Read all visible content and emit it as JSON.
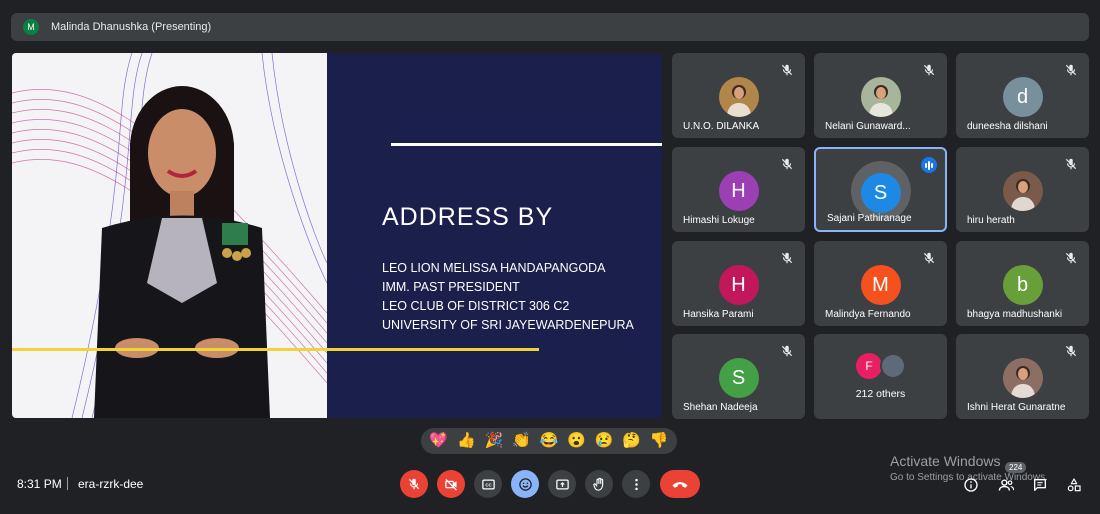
{
  "presenter": {
    "avatar_letter": "M",
    "label": "Malinda Dhanushka (Presenting)"
  },
  "slide": {
    "title": "ADDRESS BY",
    "lines": [
      "LEO LION MELISSA HANDAPANGODA",
      "IMM. PAST PRESIDENT",
      "LEO CLUB OF DISTRICT 306 C2",
      "UNIVERSITY OF SRI JAYEWARDENEPURA"
    ]
  },
  "participants": [
    {
      "name": "U.N.O. DILANKA",
      "avatar": "photo",
      "color": "#b0864a",
      "muted": true
    },
    {
      "name": "Nelani Gunaward...",
      "avatar": "photo",
      "color": "#a7b59a",
      "muted": true
    },
    {
      "name": "duneesha dilshani",
      "avatar": "d",
      "color": "#78909c",
      "muted": true
    },
    {
      "name": "Himashi Lokuge",
      "avatar": "H",
      "color": "#9c3fb5",
      "muted": true
    },
    {
      "name": "Sajani Pathiranage",
      "avatar": "S",
      "color": "#1e88e5",
      "muted": false,
      "speaking": true
    },
    {
      "name": "hiru herath",
      "avatar": "photo",
      "color": "#7a5a4a",
      "muted": true
    },
    {
      "name": "Hansika Parami",
      "avatar": "H",
      "color": "#c2185b",
      "muted": true
    },
    {
      "name": "Malindya Fernando",
      "avatar": "M",
      "color": "#f4511e",
      "muted": true
    },
    {
      "name": "bhagya madhushanki",
      "avatar": "b",
      "color": "#689f38",
      "muted": true
    },
    {
      "name": "Shehan Nadeeja",
      "avatar": "S",
      "color": "#43a047",
      "muted": true
    },
    {
      "name": "212 others",
      "avatar": "group",
      "color": "#e91e63",
      "muted": false,
      "group_letter": "F"
    },
    {
      "name": "Ishni Herat Gunaratne",
      "avatar": "photo",
      "color": "#8d6e63",
      "muted": true
    }
  ],
  "reactions": [
    "💖",
    "👍",
    "🎉",
    "👏",
    "😂",
    "😮",
    "😢",
    "🤔",
    "👎"
  ],
  "meeting": {
    "time": "8:31 PM",
    "code": "era-rzrk-dee"
  },
  "watermark": {
    "title": "Activate Windows",
    "subtitle": "Go to Settings to activate Windows."
  },
  "people_count": "224",
  "colors": {
    "background": "#202124",
    "tile": "#3c4043",
    "danger": "#ea4335",
    "accent": "#8ab4f8"
  },
  "controls": [
    "mic-off-icon",
    "camera-off-icon",
    "captions-icon",
    "emoji-icon",
    "present-icon",
    "raise-hand-icon",
    "more-options-icon",
    "end-call-icon"
  ]
}
